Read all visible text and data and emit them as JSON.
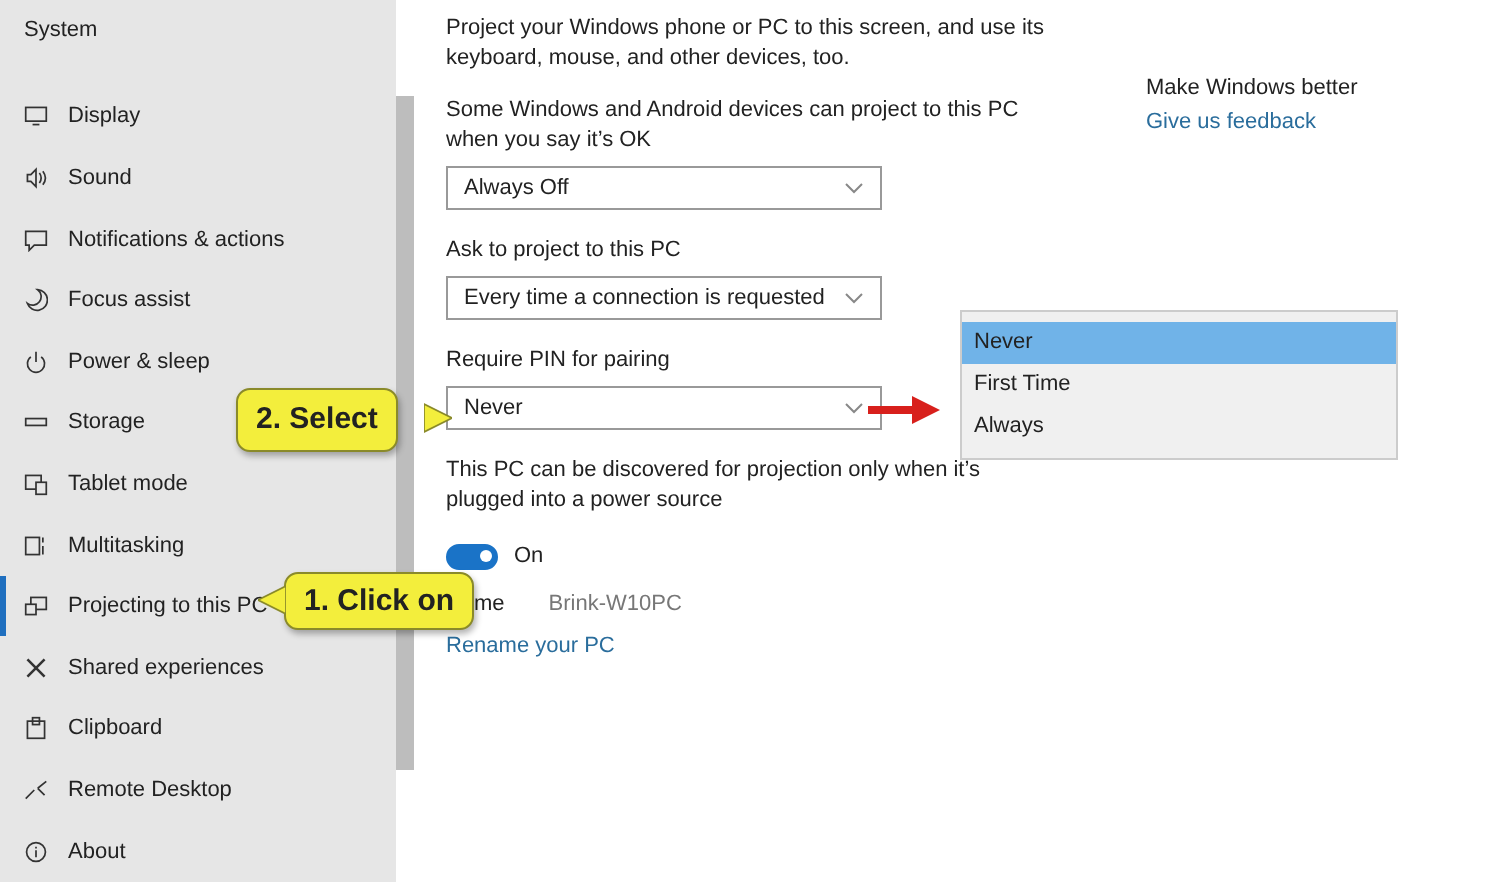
{
  "sidebar": {
    "title": "System",
    "items": [
      {
        "label": "Display",
        "selected": false
      },
      {
        "label": "Sound",
        "selected": false
      },
      {
        "label": "Notifications & actions",
        "selected": false
      },
      {
        "label": "Focus assist",
        "selected": false
      },
      {
        "label": "Power & sleep",
        "selected": false
      },
      {
        "label": "Storage",
        "selected": false
      },
      {
        "label": "Tablet mode",
        "selected": false
      },
      {
        "label": "Multitasking",
        "selected": false
      },
      {
        "label": "Projecting to this PC",
        "selected": true
      },
      {
        "label": "Shared experiences",
        "selected": false
      },
      {
        "label": "Clipboard",
        "selected": false
      },
      {
        "label": "Remote Desktop",
        "selected": false
      },
      {
        "label": "About",
        "selected": false
      }
    ]
  },
  "main": {
    "intro": "Project your Windows phone or PC to this screen, and use its keyboard, mouse, and other devices, too.",
    "settings": [
      {
        "label": "Some Windows and Android devices can project to this PC when you say it’s OK",
        "value": "Always Off"
      },
      {
        "label": "Ask to project to this PC",
        "value": "Every time a connection is requested"
      },
      {
        "label": "Require PIN for pairing",
        "value": "Never"
      }
    ],
    "power_note": "This PC can be discovered for projection only when it’s plugged into a power source",
    "toggle": {
      "on": true,
      "label": "On"
    },
    "pc_name": {
      "label": "me",
      "value": "Brink-W10PC"
    },
    "rename_link": "Rename your PC"
  },
  "side_panel": {
    "heading": "Make Windows better",
    "link": "Give us feedback"
  },
  "dropdown_list": {
    "options": [
      {
        "label": "Never",
        "selected": true
      },
      {
        "label": "First Time",
        "selected": false
      },
      {
        "label": "Always",
        "selected": false
      }
    ]
  },
  "callouts": [
    {
      "text": "2. Select"
    },
    {
      "text": "1. Click on"
    }
  ]
}
